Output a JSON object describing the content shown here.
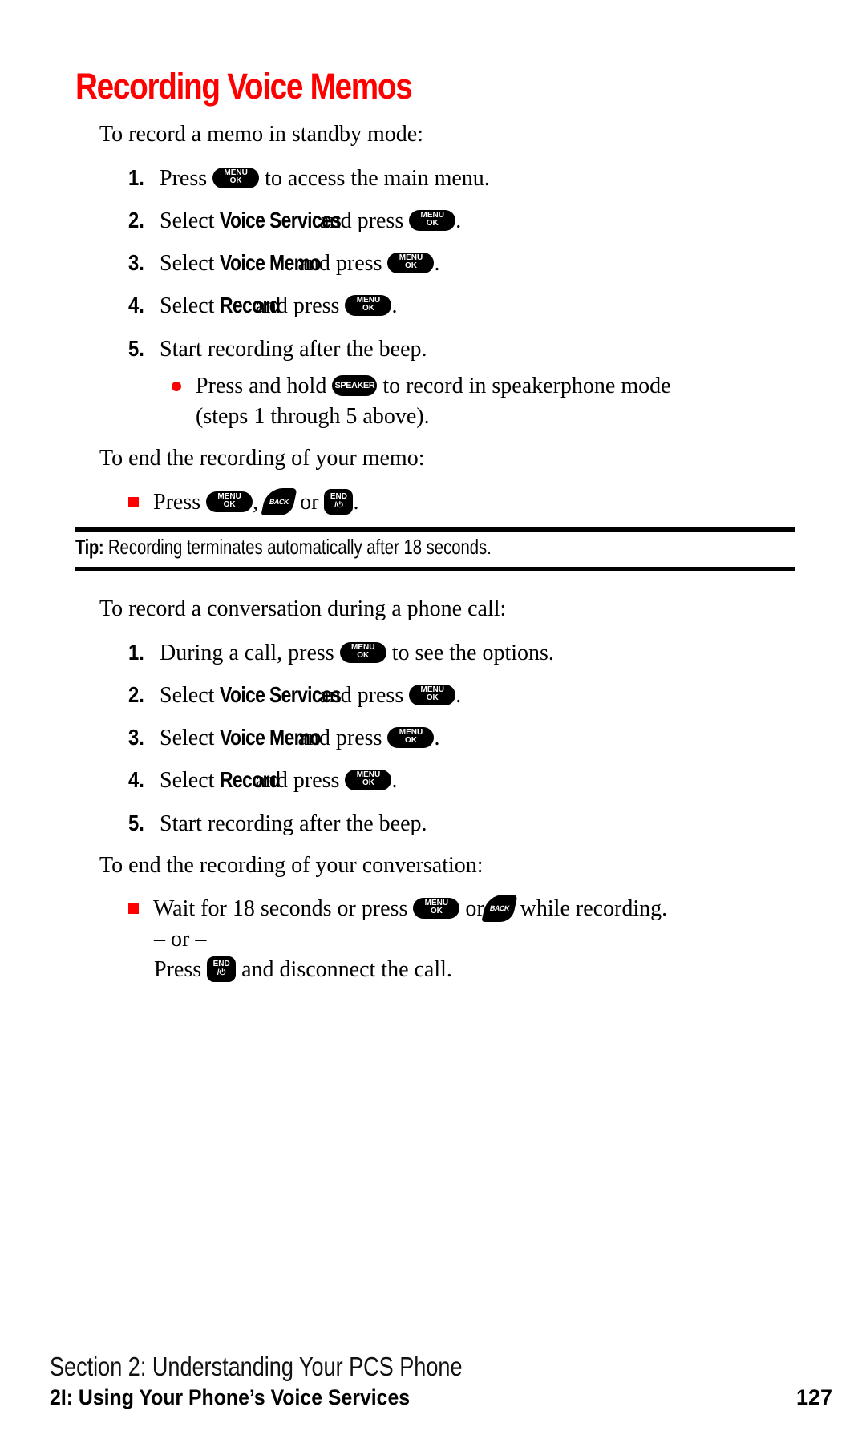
{
  "title": "Recording Voice Memos",
  "standby": {
    "intro": "To record a memo in standby mode:",
    "steps": [
      {
        "num": "1.",
        "pre": "Press",
        "bold": "",
        "mid": "",
        "key": "menu",
        "post": "to access the main menu."
      },
      {
        "num": "2.",
        "pre": "Select",
        "bold": "Voice Services",
        "mid": "and press",
        "key": "menu",
        "post": "."
      },
      {
        "num": "3.",
        "pre": "Select",
        "bold": "Voice Memo",
        "mid": "and press",
        "key": "menu",
        "post": "."
      },
      {
        "num": "4.",
        "pre": "Select",
        "bold": "Record",
        "mid": "and press",
        "key": "menu",
        "post": "."
      },
      {
        "num": "5.",
        "pre": "Start recording after the beep.",
        "bold": "",
        "mid": "",
        "key": "",
        "post": ""
      }
    ],
    "bullet": {
      "pre": "Press and hold",
      "post": "to record in speakerphone mode",
      "line2": "(steps 1 through 5 above)."
    },
    "end_intro": "To end the recording of your memo:",
    "end_item": {
      "pre": "Press",
      "comma": ",",
      "or": "or",
      "period": "."
    }
  },
  "tip": {
    "label": "Tip:",
    "text": "Recording terminates automatically after 18 seconds."
  },
  "call": {
    "intro": "To record a conversation during a phone call:",
    "steps": [
      {
        "num": "1.",
        "pre": "During a call, press",
        "post": "to see the options."
      },
      {
        "num": "2.",
        "pre": "Select",
        "bold": "Voice Services",
        "mid": "and press",
        "post": "."
      },
      {
        "num": "3.",
        "pre": "Select",
        "bold": "Voice Memo",
        "mid": "and press",
        "post": "."
      },
      {
        "num": "4.",
        "pre": "Select",
        "bold": "Record",
        "mid": "and press",
        "post": "."
      },
      {
        "num": "5.",
        "pre": "Start recording after the beep."
      }
    ],
    "end_intro": "To end the recording of your conversation:",
    "end_item": {
      "pre": "Wait for 18 seconds or press",
      "or": "or",
      "post": "while recording.",
      "separator": "– or –",
      "alt_pre": "Press",
      "alt_post": "and disconnect the call."
    }
  },
  "keys": {
    "menu_top": "MENU",
    "menu_bottom": "OK",
    "speaker": "SPEAKER",
    "back": "BACK",
    "end_top": "END",
    "end_bottom": "/⏻"
  },
  "footer": {
    "section": "Section 2: Understanding Your PCS Phone",
    "chapter": "2I: Using Your Phone’s Voice Services",
    "page": "127"
  },
  "colors": {
    "accent": "#ff0000",
    "text": "#000000"
  }
}
